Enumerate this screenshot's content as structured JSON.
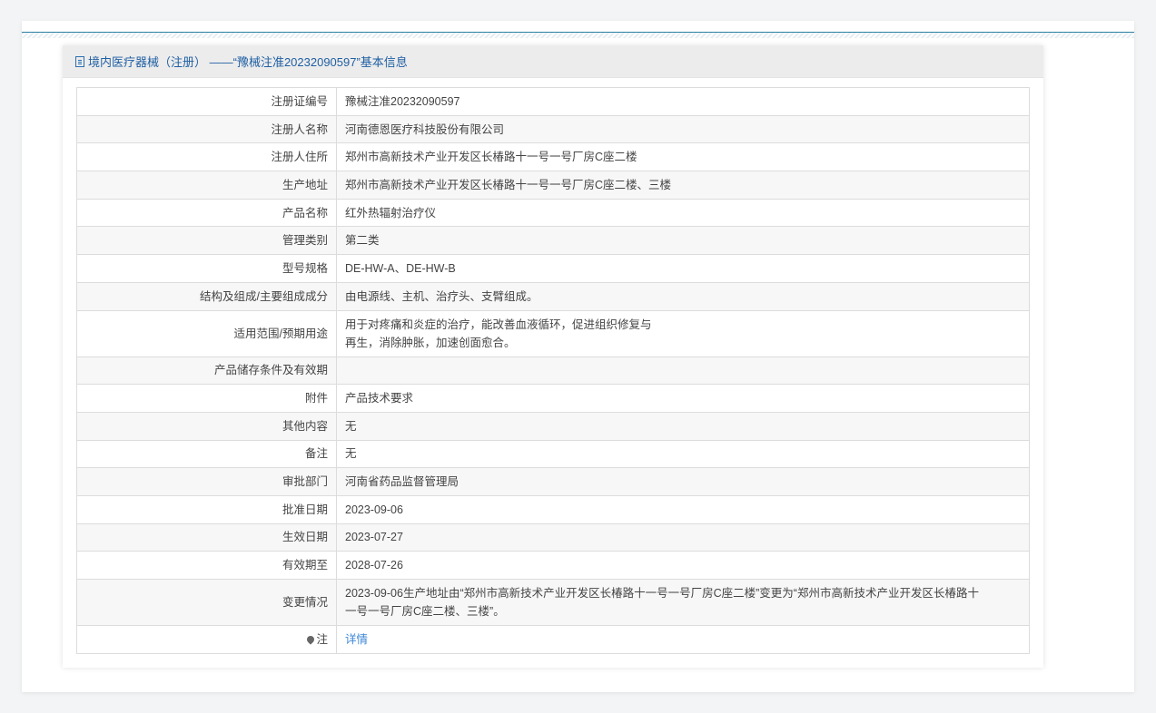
{
  "header": {
    "title": "境内医疗器械（注册） ——“豫械注准20232090597”基本信息"
  },
  "rows": [
    {
      "label": "注册证编号",
      "value": "豫械注准20232090597"
    },
    {
      "label": "注册人名称",
      "value": "河南德恩医疗科技股份有限公司"
    },
    {
      "label": "注册人住所",
      "value": "郑州市高新技术产业开发区长椿路十一号一号厂房C座二楼"
    },
    {
      "label": "生产地址",
      "value": "郑州市高新技术产业开发区长椿路十一号一号厂房C座二楼、三楼"
    },
    {
      "label": "产品名称",
      "value": "红外热辐射治疗仪"
    },
    {
      "label": "管理类别",
      "value": "第二类"
    },
    {
      "label": "型号规格",
      "value": "DE-HW-A、DE-HW-B"
    },
    {
      "label": "结构及组成/主要组成成分",
      "value": "由电源线、主机、治疗头、支臂组成。"
    },
    {
      "label": "适用范围/预期用途",
      "value_line1": "用于对疼痛和炎症的治疗，能改善血液循环，促进组织修复与",
      "value_line2": "再生，消除肿胀，加速创面愈合。"
    },
    {
      "label": "产品储存条件及有效期",
      "value": ""
    },
    {
      "label": "附件",
      "value": "产品技术要求"
    },
    {
      "label": "其他内容",
      "value": "无"
    },
    {
      "label": "备注",
      "value": "无"
    },
    {
      "label": "审批部门",
      "value": "河南省药品监督管理局"
    },
    {
      "label": "批准日期",
      "value": "2023-09-06"
    },
    {
      "label": "生效日期",
      "value": "2023-07-27"
    },
    {
      "label": "有效期至",
      "value": "2028-07-26"
    },
    {
      "label": "变更情况",
      "value_line1": "2023-09-06生产地址由“郑州市高新技术产业开发区长椿路十一号一号厂房C座二楼”变更为“郑州市高新技术产业开发区长椿路十",
      "value_line2": "一号一号厂房C座二楼、三楼”。"
    },
    {
      "label": "注",
      "value": "详情"
    }
  ]
}
